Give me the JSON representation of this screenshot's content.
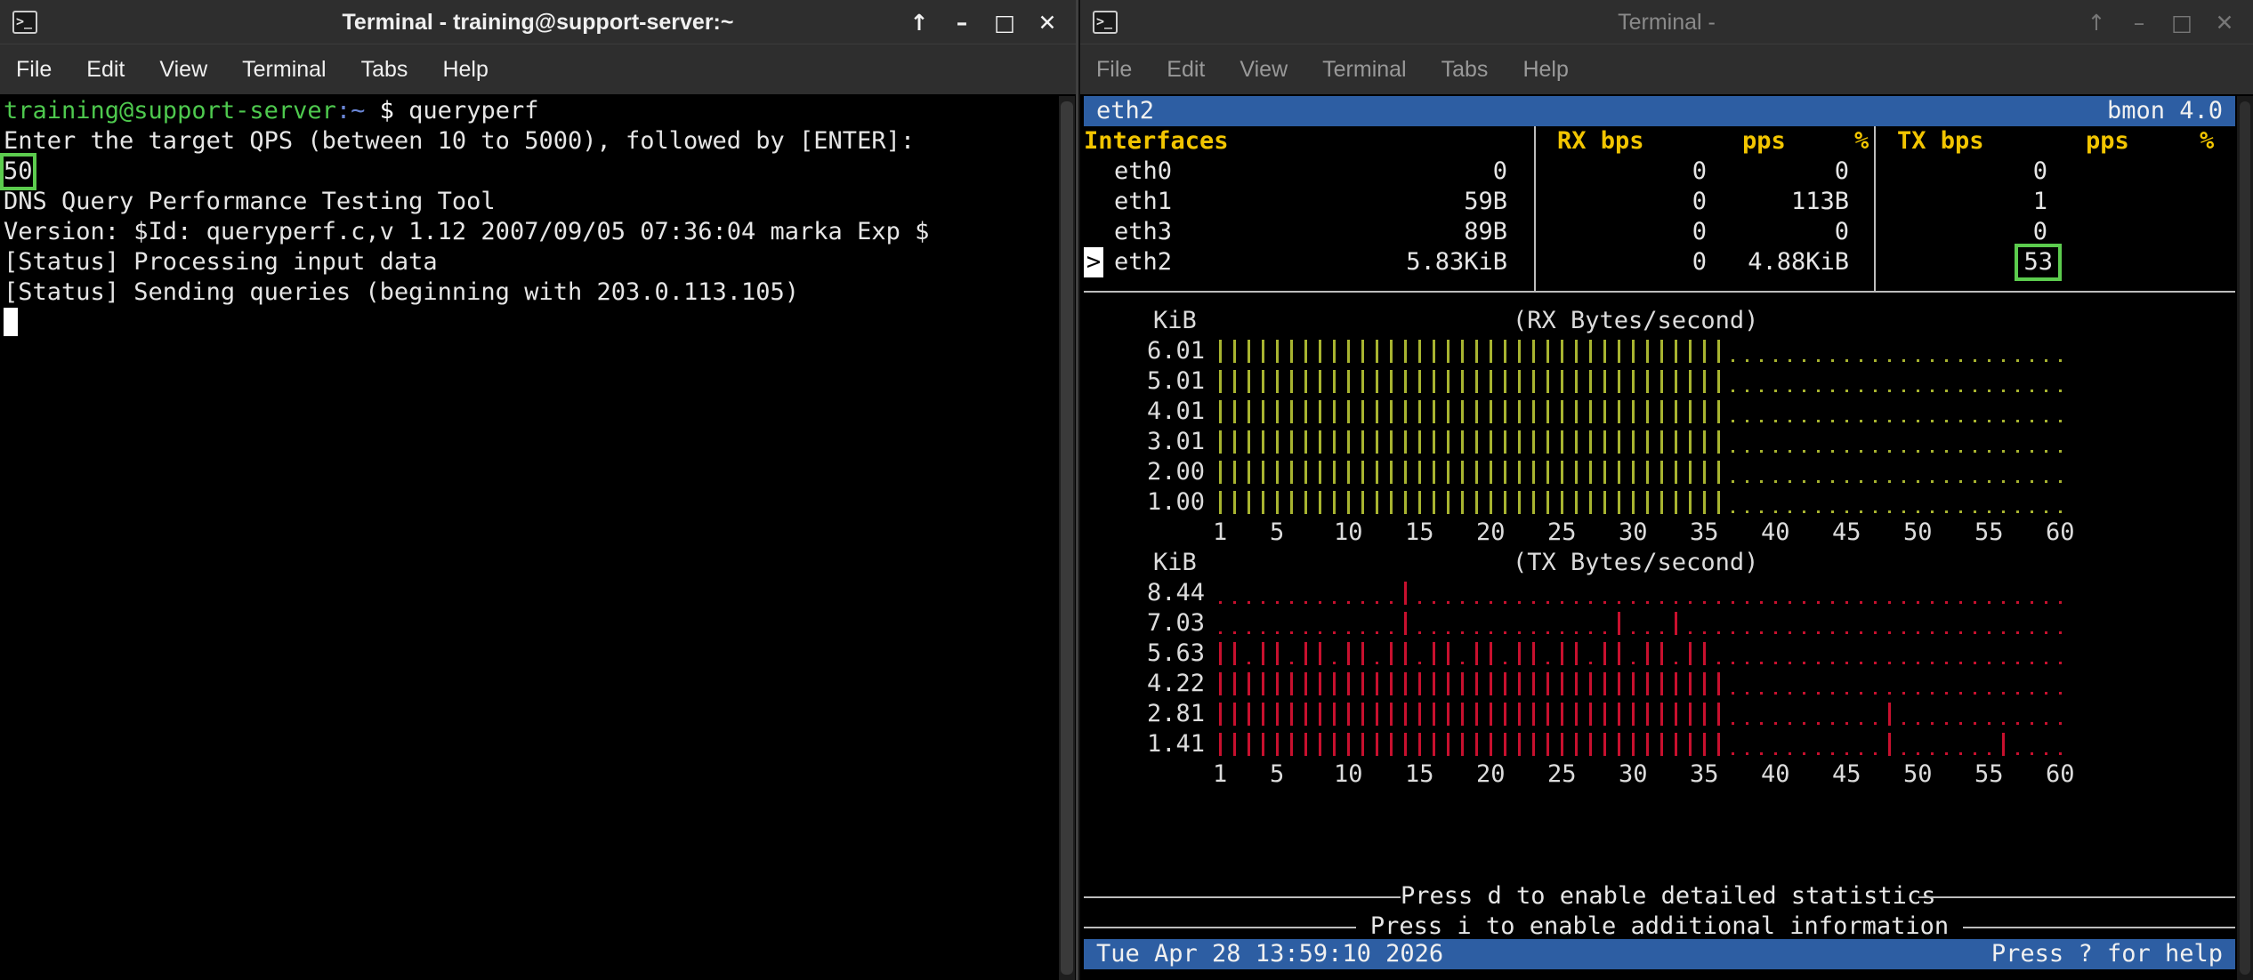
{
  "left": {
    "title": "Terminal - training@support-server:~",
    "menu": [
      "File",
      "Edit",
      "View",
      "Terminal",
      "Tabs",
      "Help"
    ],
    "prompt_user": "training@support-server",
    "prompt_path": ":~",
    "prompt_sym": " $ ",
    "command": "queryperf",
    "lines": [
      "Enter the target QPS (between 10 to 5000), followed by [ENTER]:",
      "50",
      "",
      "DNS Query Performance Testing Tool",
      "Version: $Id: queryperf.c,v 1.12 2007/09/05 07:36:04 marka Exp $",
      "",
      "[Status] Processing input data",
      "[Status] Sending queries (beginning with 203.0.113.105)"
    ]
  },
  "right": {
    "title": "Terminal -",
    "menu": [
      "File",
      "Edit",
      "View",
      "Terminal",
      "Tabs",
      "Help"
    ],
    "bmon": {
      "current_iface": "eth2",
      "version": "bmon 4.0",
      "headers": {
        "interfaces": "Interfaces",
        "rx_bps": "RX bps",
        "rx_pps": "pps",
        "rx_pct": "%",
        "tx_bps": "TX bps",
        "tx_pps": "pps",
        "tx_pct": "%"
      },
      "selector": ">",
      "rows": [
        {
          "name": "eth0",
          "rx_bps": "0",
          "rx_pps": "0",
          "tx_bps": "0",
          "tx_pps": "0"
        },
        {
          "name": "eth1",
          "rx_bps": "59B",
          "rx_pps": "0",
          "tx_bps": "113B",
          "tx_pps": "1"
        },
        {
          "name": "eth3",
          "rx_bps": "89B",
          "rx_pps": "0",
          "tx_bps": "0",
          "tx_pps": "0"
        },
        {
          "name": "eth2",
          "rx_bps": "5.83KiB",
          "rx_pps": "0",
          "tx_bps": "4.88KiB",
          "tx_pps": "53"
        }
      ],
      "rx_graph": {
        "unit": "KiB",
        "title": "(RX Bytes/second)",
        "y": [
          "6.01",
          "5.01",
          "4.01",
          "3.01",
          "2.00",
          "1.00"
        ]
      },
      "tx_graph": {
        "unit": "KiB",
        "title": "(TX Bytes/second)",
        "y": [
          "8.44",
          "7.03",
          "5.63",
          "4.22",
          "2.81",
          "1.41"
        ]
      },
      "x_ticks": [
        "1",
        "5",
        "10",
        "15",
        "20",
        "25",
        "30",
        "35",
        "40",
        "45",
        "50",
        "55",
        "60"
      ],
      "hint_d": "Press d to enable detailed statistics",
      "hint_i": "Press i to enable additional information",
      "clock": "Tue Apr 28 13:59:10 2026",
      "help": "Press ? for help",
      "rx_color": "#a8b430",
      "tx_color": "#c8102e"
    }
  }
}
